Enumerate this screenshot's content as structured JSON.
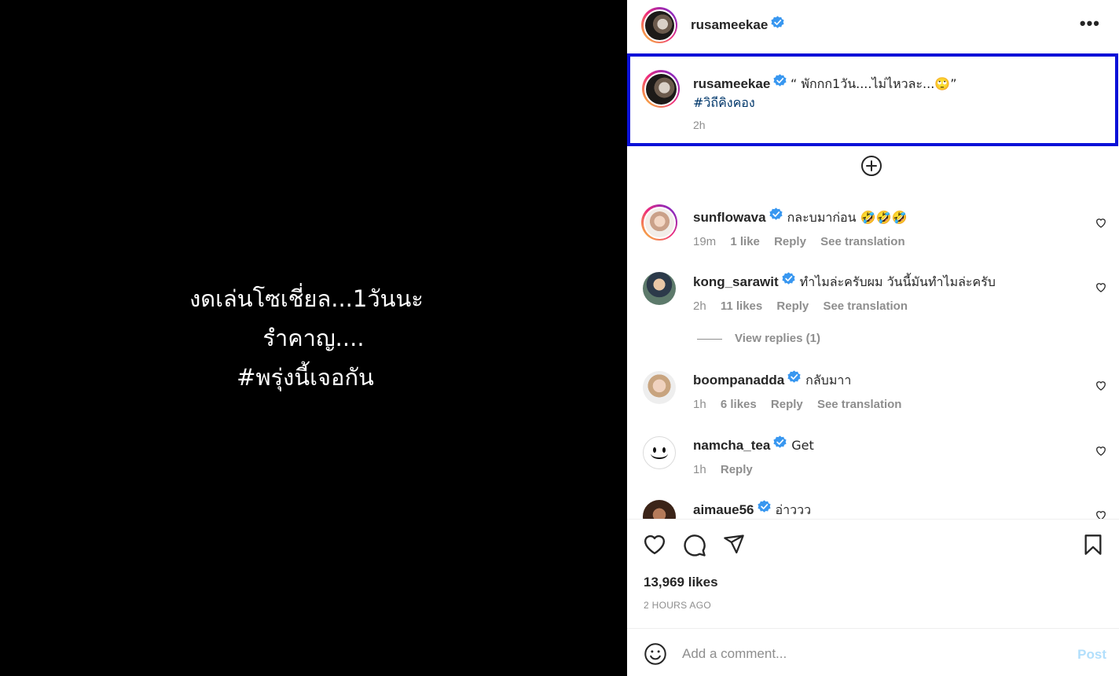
{
  "media": {
    "lines": [
      "งดเล่นโซเชี่ยล...1วันนะ",
      "รำคาญ....",
      "#พรุ่งนี้เจอกัน"
    ]
  },
  "header": {
    "username": "rusameekae",
    "more_label": "•••"
  },
  "caption": {
    "username": "rusameekae",
    "text": "“ พักกก1วัน....ไม่ไหวละ...🙄”",
    "hashtag": "#วิถีคิงคอง",
    "time": "2h"
  },
  "comments": [
    {
      "username": "sunflowava",
      "text": "กละบมาก่อน 🤣🤣🤣",
      "time": "19m",
      "likes": "1 like",
      "reply": "Reply",
      "translate": "See translation"
    },
    {
      "username": "kong_sarawit",
      "text": "ทำไมล่ะครับผม วันนี้มันทำไมล่ะครับ",
      "time": "2h",
      "likes": "11 likes",
      "reply": "Reply",
      "translate": "See translation",
      "view_replies": "View replies (1)"
    },
    {
      "username": "boompanadda",
      "text": "กลับมาา",
      "time": "1h",
      "likes": "6 likes",
      "reply": "Reply",
      "translate": "See translation"
    },
    {
      "username": "namcha_tea",
      "text": "Get",
      "time": "1h",
      "reply": "Reply"
    },
    {
      "username": "aimaue56",
      "text": "อ่าววว"
    }
  ],
  "footer": {
    "likes": "13,969 likes",
    "posted": "2 HOURS AGO",
    "comment_placeholder": "Add a comment...",
    "post_label": "Post"
  },
  "icons": {
    "verified_color": "#3897f0",
    "highlight_color": "#0a11d8",
    "link_color": "#00376b"
  }
}
